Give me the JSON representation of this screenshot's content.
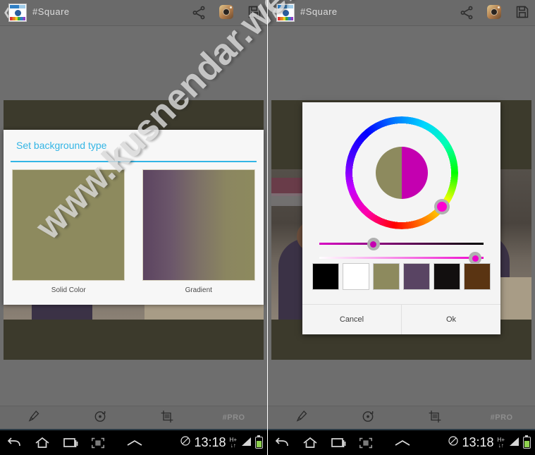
{
  "appbar": {
    "title": "#Square",
    "back_icon": "chevron-left-icon",
    "app_icon": "app-logo-icon",
    "actions": [
      {
        "name": "share-icon",
        "label": "Share"
      },
      {
        "name": "instagram-icon",
        "label": "Instagram"
      },
      {
        "name": "save-icon",
        "label": "Save"
      }
    ]
  },
  "toolbar": {
    "items": [
      {
        "name": "eyedropper-icon",
        "label": ""
      },
      {
        "name": "rotate-icon",
        "label": ""
      },
      {
        "name": "crop-icon",
        "label": ""
      },
      {
        "name": "pro-label",
        "label": "#PRO"
      }
    ]
  },
  "navbar": {
    "back": "back-icon",
    "home": "home-icon",
    "recents": "recents-icon",
    "screenshot": "screenshot-icon",
    "expand": "chevron-up-icon",
    "status": {
      "mute": "mute-icon",
      "time": "13:18",
      "data": "H+",
      "data_sub": "↓↑",
      "signal": "signal-icon",
      "battery": "battery-icon"
    }
  },
  "background_dialog": {
    "title": "Set background type",
    "options": [
      {
        "label": "Solid Color",
        "swatch": "#8d8a5e",
        "type": "solid"
      },
      {
        "label": "Gradient",
        "swatch": "#5c4460",
        "type": "gradient"
      }
    ]
  },
  "color_picker": {
    "preview_old": "#8d8a5e",
    "preview_new": "#c400b0",
    "selected_hue": "#ff00d0",
    "wheel_knob_angle_deg": 40,
    "sliders": [
      {
        "name": "value-slider",
        "from": "#d900c4",
        "to": "#000000",
        "position_pct": 33,
        "knob_color": "#c400b0"
      },
      {
        "name": "saturation-slider",
        "from": "#ffffff",
        "to": "#ee00cc",
        "position_pct": 95,
        "knob_color": "#ee00cc"
      }
    ],
    "swatches": [
      "#000000",
      "#ffffff",
      "#8d8a5e",
      "#594463",
      "#120f0f",
      "#5a3412"
    ],
    "buttons": {
      "cancel": "Cancel",
      "ok": "Ok"
    }
  },
  "canvas": {
    "background_color": "#3c3a2c"
  },
  "watermark": {
    "text": "www.kusnendar.web.id"
  }
}
